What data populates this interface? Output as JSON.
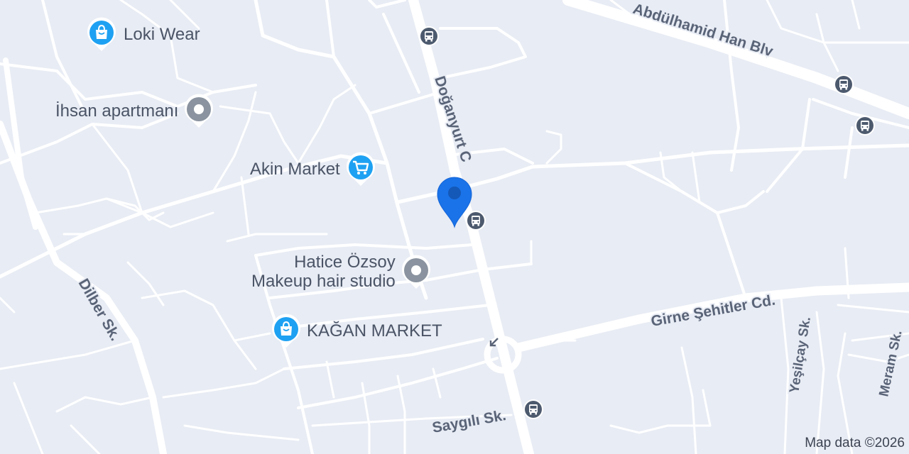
{
  "map": {
    "background_color": "#e8ecf4",
    "road_color": "#ffffff",
    "label_color": "#5a6478",
    "poi_blue": "#1ea1f2",
    "poi_gray": "#8a939f",
    "selected_pin_color": "#1a73e8"
  },
  "roads": {
    "abdulhamid": "Abdülhamid Han Blv",
    "doganyurt": "Doğanyurt C",
    "girne": "Girne Şehitler Cd.",
    "dilber": "Dilber Sk.",
    "saygili": "Saygılı Sk.",
    "yesilcay": "Yeşilçay Sk.",
    "meram": "Meram Sk."
  },
  "pois": {
    "loki": {
      "label": "Loki Wear",
      "icon": "shopping-bag-icon"
    },
    "ihsan": {
      "label": "İhsan apartmanı",
      "icon": "place-icon"
    },
    "akin": {
      "label": "Akin Market",
      "icon": "shopping-cart-icon"
    },
    "hatice_line1": "Hatice Özsoy",
    "hatice_line2": "Makeup hair studio",
    "hatice_icon": "place-icon",
    "kagan": {
      "label": "KAĞAN MARKET",
      "icon": "shopping-bag-icon"
    }
  },
  "bus_stop_icon": "bus-stop-icon",
  "attribution": "Map data ©2026"
}
